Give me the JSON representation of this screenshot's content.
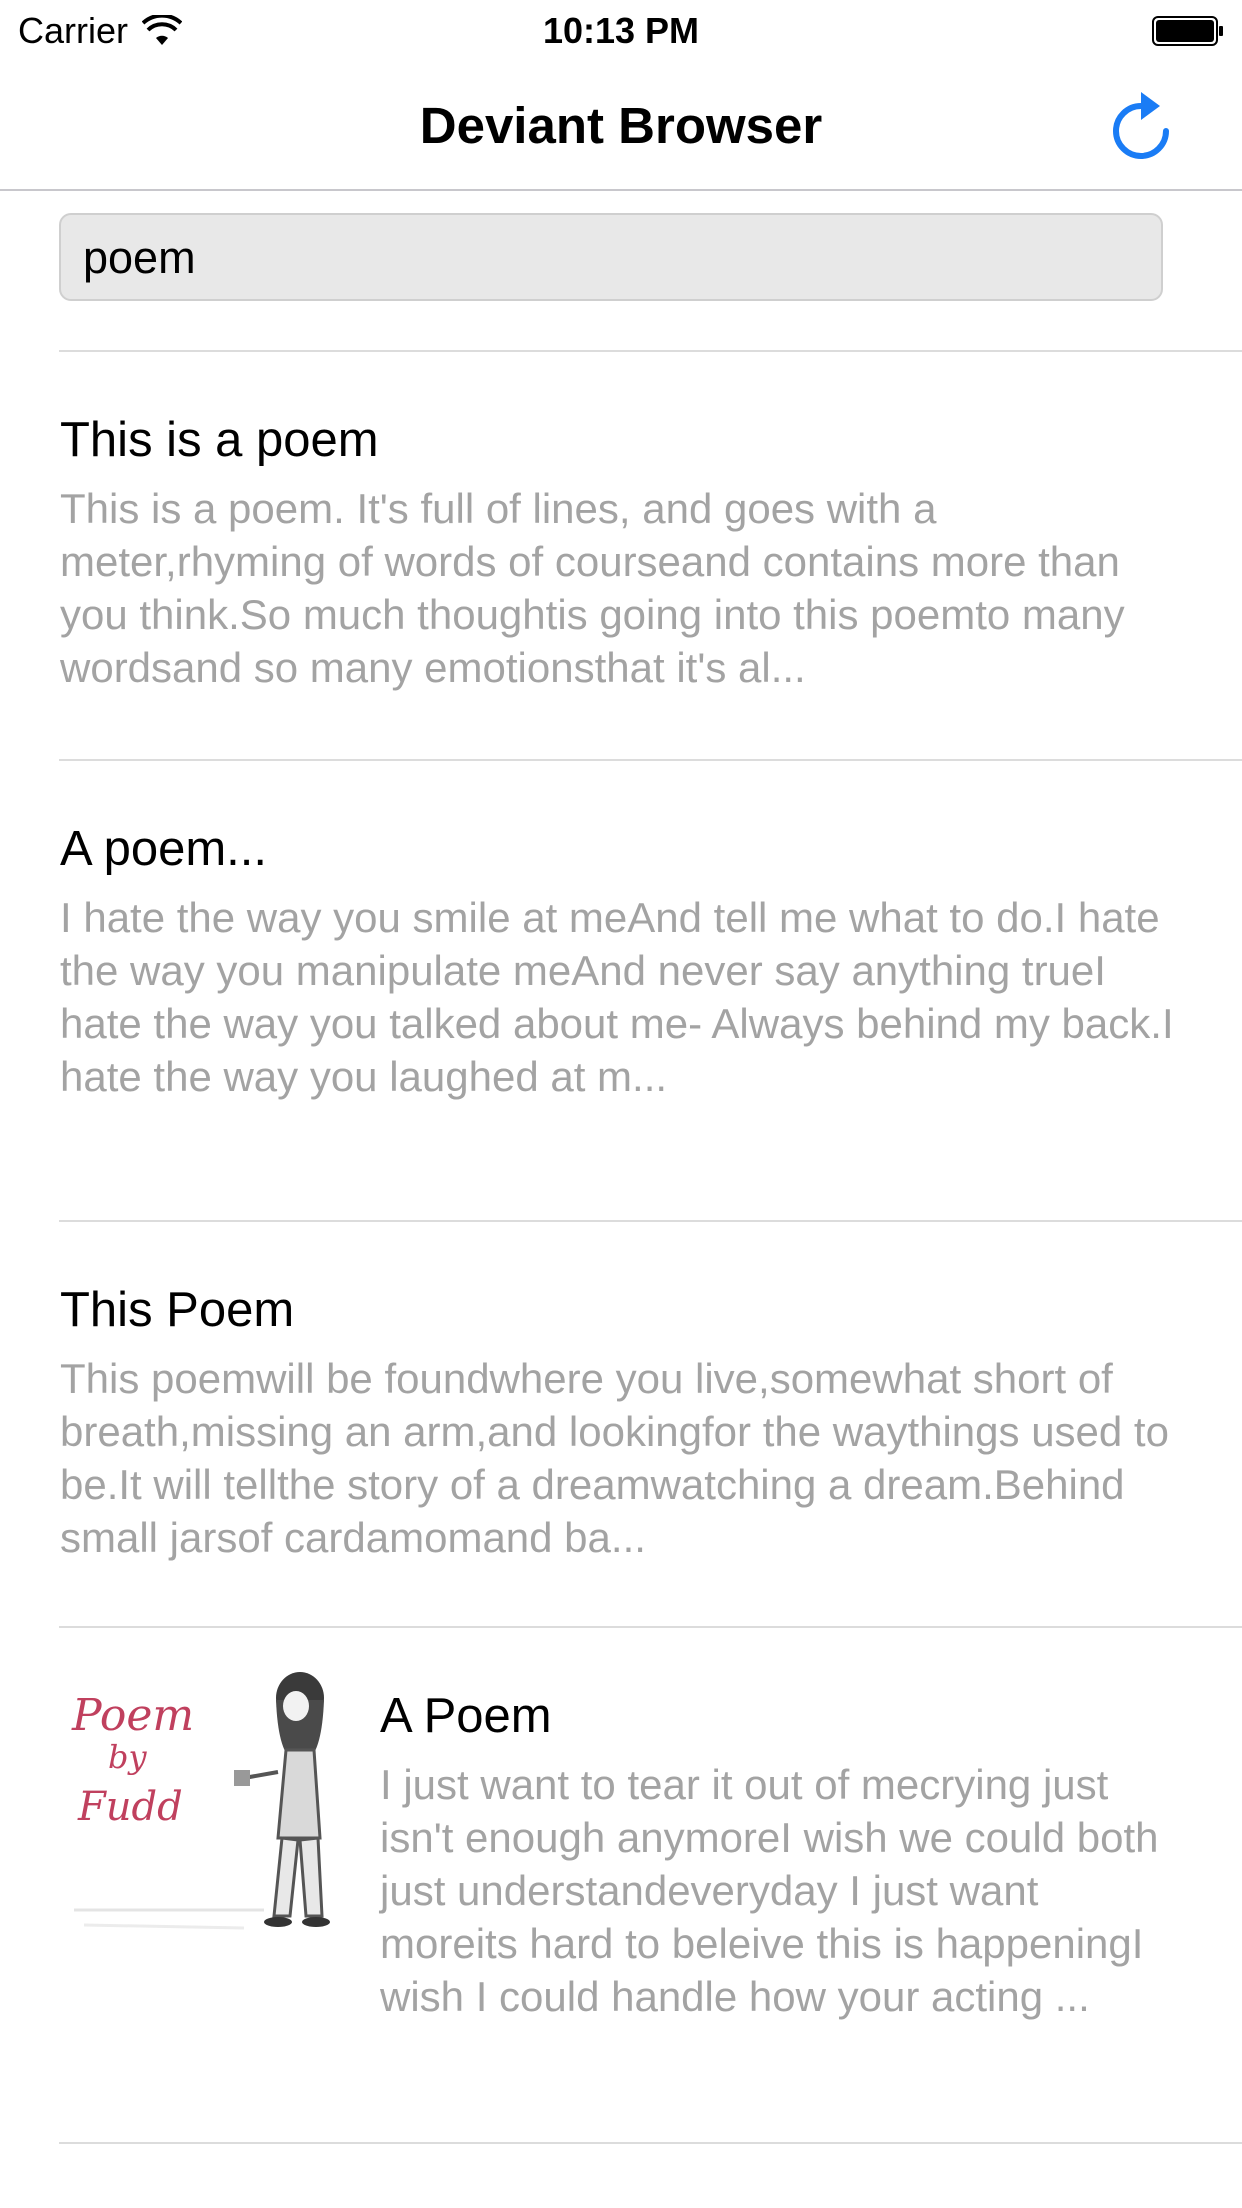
{
  "status_bar": {
    "carrier": "Carrier",
    "time": "10:13 PM"
  },
  "nav": {
    "title": "Deviant Browser",
    "refresh_icon": "refresh-icon",
    "accent_color": "#1a7cf5"
  },
  "search": {
    "value": "poem"
  },
  "results": [
    {
      "title": "This is a poem",
      "body": "This is a poem. It's full of lines, and goes with a meter,rhyming of words of courseand contains more than you think.So much thoughtis going into this poemto many wordsand so many emotionsthat it's al..."
    },
    {
      "title": "A poem...",
      "body": "I hate the way you smile at meAnd tell me what to do.I hate the way you manipulate meAnd never say anything trueI hate the way you talked about me- Always behind my back.I hate the way you laughed at m..."
    },
    {
      "title": "This Poem",
      "body": "This poemwill be foundwhere you live,somewhat short of breath,missing an arm,and lookingfor the waythings used to be.It will tellthe story of a dreamwatching a dream.Behind small jarsof cardamomand ba..."
    },
    {
      "title": "A Poem",
      "body": "I just want to tear it out of mecrying just isn't enough anymoreI wish we could both just understandeveryday I just want moreits hard to beleive this is happeningI wish I could handle how your acting ...",
      "thumbnail_text": [
        "Poem",
        "by",
        "Fudd"
      ]
    }
  ]
}
